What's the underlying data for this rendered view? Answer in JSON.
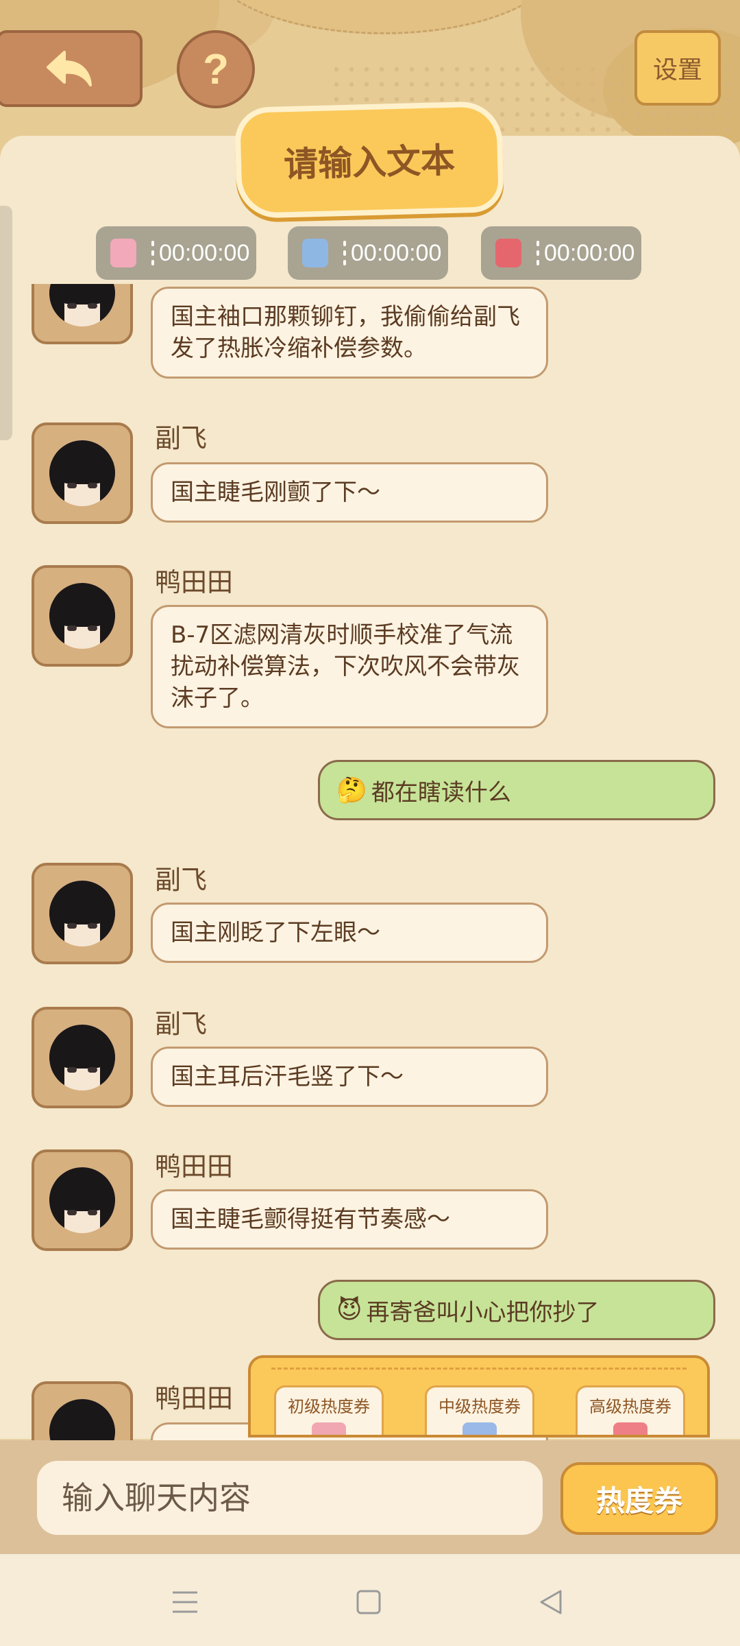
{
  "header": {
    "title": "请输入文本",
    "settings_label": "设置",
    "help_label": "?"
  },
  "timers": [
    {
      "value": "00:00:00",
      "icon": "pink-gift-icon",
      "color": "#f2a9b9"
    },
    {
      "value": "00:00:00",
      "icon": "blue-gift-icon",
      "color": "#8fb7e3"
    },
    {
      "value": "00:00:00",
      "icon": "red-gift-icon",
      "color": "#e5676d"
    }
  ],
  "messages": [
    {
      "type": "other",
      "sender": "",
      "text": "国主袖口那颗铆钉，我偷偷给副飞发了热胀冷缩补偿参数。"
    },
    {
      "type": "other",
      "sender": "副飞",
      "text": "国主睫毛刚颤了下～"
    },
    {
      "type": "other",
      "sender": "鸭田田",
      "text": "B-7区滤网清灰时顺手校准了气流扰动补偿算法，下次吹风不会带灰沫子了。"
    },
    {
      "type": "self",
      "emoji": "🤔",
      "text": "都在瞎读什么"
    },
    {
      "type": "other",
      "sender": "副飞",
      "text": "国主刚眨了下左眼～"
    },
    {
      "type": "other",
      "sender": "副飞",
      "text": "国主耳后汗毛竖了下～"
    },
    {
      "type": "other",
      "sender": "鸭田田",
      "text": "国主睫毛颤得挺有节奏感～"
    },
    {
      "type": "self",
      "emoji": "😈",
      "text": "再寄爸叫小心把你抄了"
    },
    {
      "type": "other",
      "sender": "鸭田田",
      "text": ""
    }
  ],
  "vouchers": [
    {
      "label": "初级热度券",
      "color": "#f0a7b2"
    },
    {
      "label": "中级热度券",
      "color": "#9ab9e8"
    },
    {
      "label": "高级热度券",
      "color": "#ee7f86"
    }
  ],
  "input": {
    "placeholder": "输入聊天内容",
    "hot_button": "热度券"
  },
  "colors": {
    "accent": "#fbc95a",
    "bubble_self": "#c6e398",
    "bubble_other": "#fdf3e2",
    "panel": "#f5e8cc"
  }
}
